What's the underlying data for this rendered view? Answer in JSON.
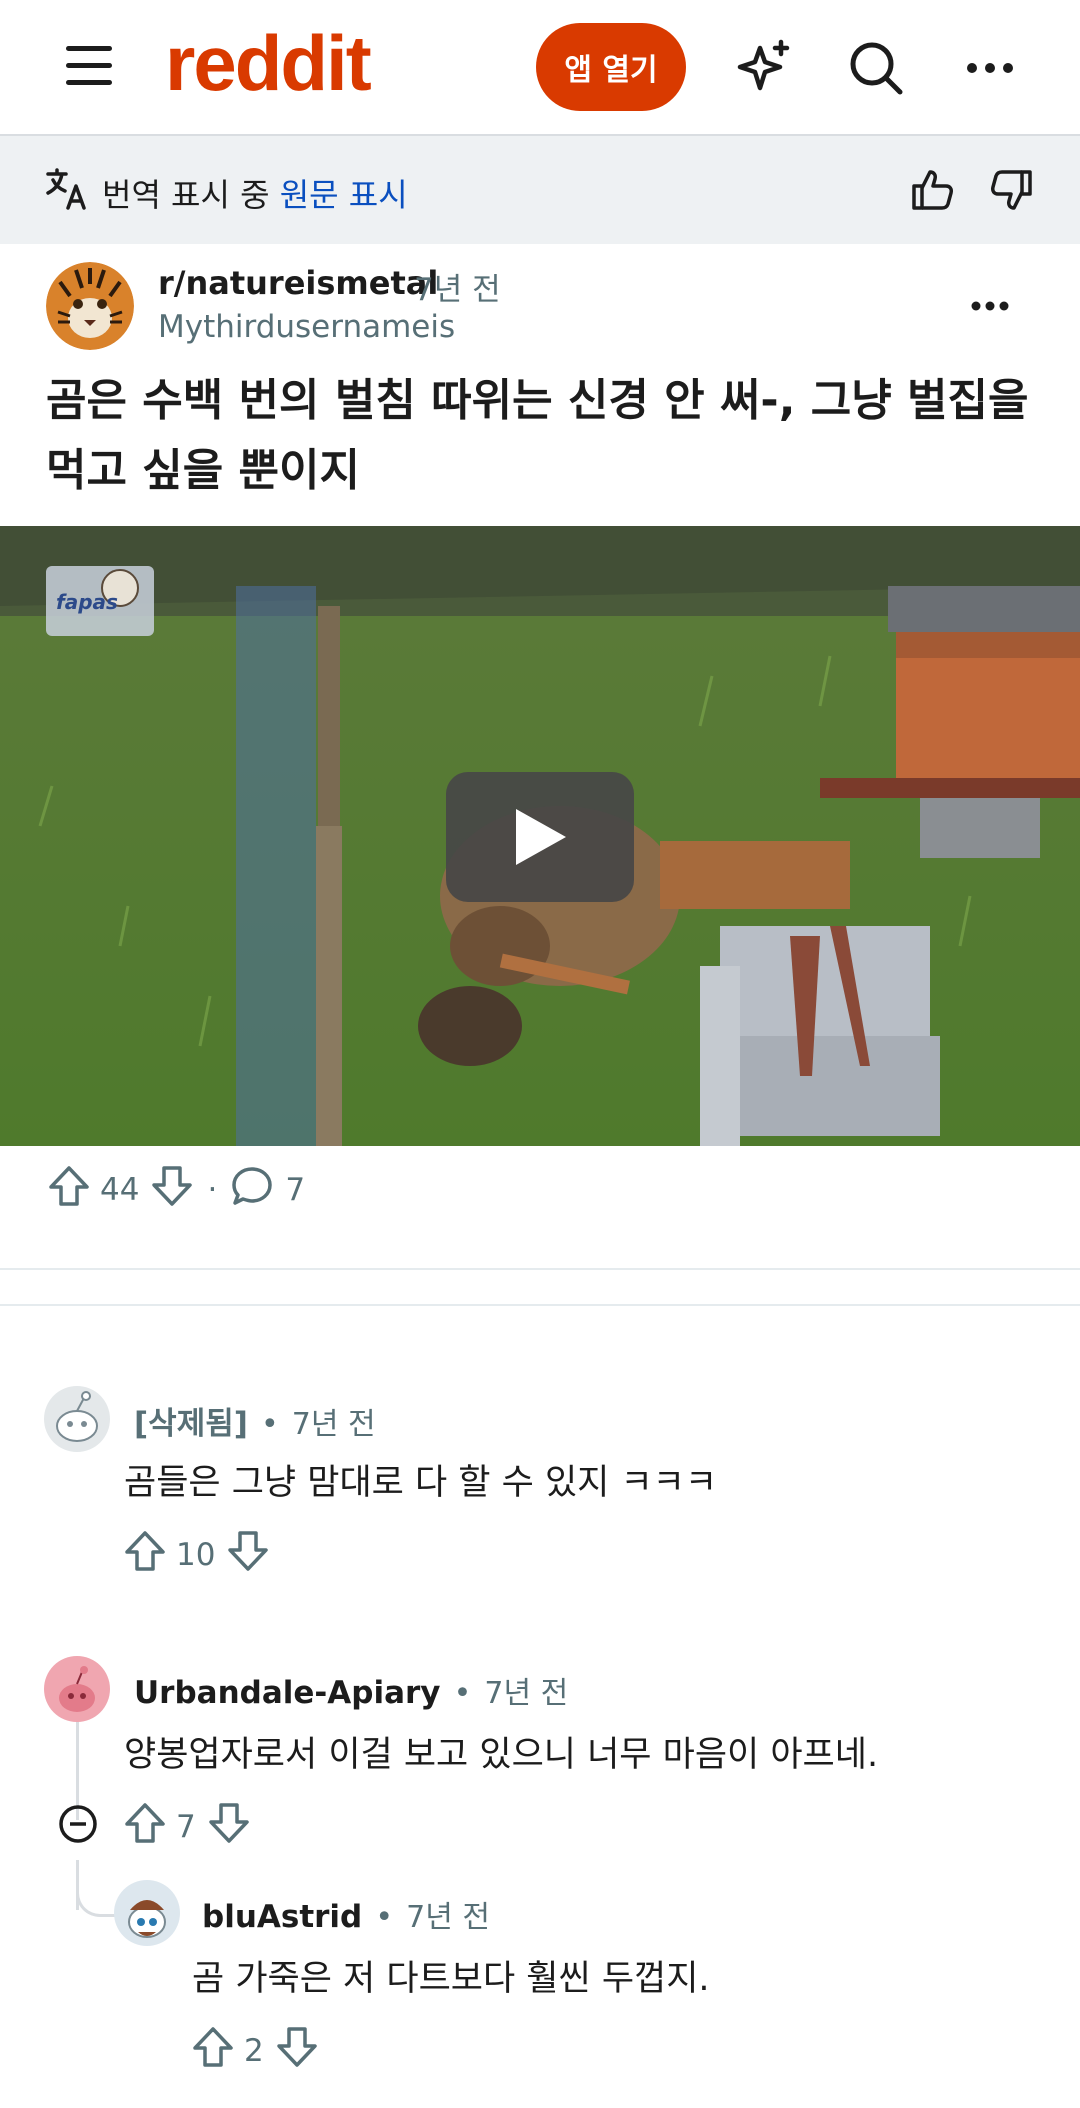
{
  "header": {
    "logo": "reddit",
    "open_app_label": "앱 열기",
    "colors": {
      "brand": "#d93a00",
      "link": "#0a4fbf"
    },
    "icons": [
      "menu-icon",
      "sparkle-icon",
      "search-icon",
      "more-icon"
    ]
  },
  "translate_bar": {
    "status": "번역 표시 중",
    "show_original": "원문 표시"
  },
  "post": {
    "subreddit": "r/natureismetal",
    "time": "7년 전",
    "author": "Mythirdusernameis",
    "title": "곰은 수백 번의 벌침 따위는 신경 안 써-, 그냥 벌집을 먹고 싶을 뿐이지",
    "video_watermark": "fapas",
    "upvotes": "44",
    "comments": "7",
    "separator": "·"
  },
  "comments": [
    {
      "user": "[삭제됨]",
      "time": "7년 전",
      "body": "곰들은 그냥 맘대로 다 할 수 있지 ㅋㅋㅋ",
      "votes": "10"
    },
    {
      "user": "Urbandale-Apiary",
      "time": "7년 전",
      "body": "양봉업자로서 이걸 보고 있으니 너무 마음이 아프네.",
      "votes": "7"
    },
    {
      "user": "bluAstrid",
      "time": "7년 전",
      "body": "곰 가죽은 저 다트보다 훨씬 두껍지.",
      "votes": "2"
    }
  ],
  "meta_dot": "•"
}
